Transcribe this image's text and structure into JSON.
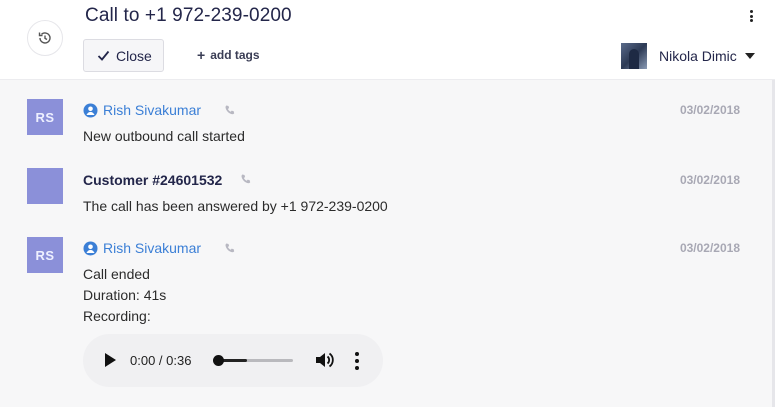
{
  "header": {
    "title": "Call to +1 972-239-0200",
    "close_label": "Close",
    "add_tags_label": "add tags",
    "user_name": "Nikola Dimic",
    "icons": [
      "history-icon",
      "more-vertical-icon",
      "check-icon",
      "plus-icon",
      "caret-down-icon"
    ]
  },
  "messages": [
    {
      "avatar_initials": "RS",
      "sender": "Rish Sivakumar",
      "sender_type": "agent",
      "date": "03/02/2018",
      "lines": [
        "New outbound call started"
      ]
    },
    {
      "avatar_initials": "",
      "sender": "Customer #24601532",
      "sender_type": "customer",
      "date": "03/02/2018",
      "lines": [
        "The call has been answered by +1 972-239-0200"
      ]
    },
    {
      "avatar_initials": "RS",
      "sender": "Rish Sivakumar",
      "sender_type": "agent",
      "date": "03/02/2018",
      "lines": [
        "Call ended",
        "Duration: 41s",
        "Recording:"
      ]
    }
  ],
  "audio_player": {
    "time_display": "0:00 / 0:36",
    "progress": 0.0,
    "buffered": 0.4
  },
  "colors": {
    "avatar_bg": "#8b90d9",
    "agent_name": "#3b7fd6",
    "date_text": "#a8a8b4",
    "title_text": "#23264a"
  }
}
